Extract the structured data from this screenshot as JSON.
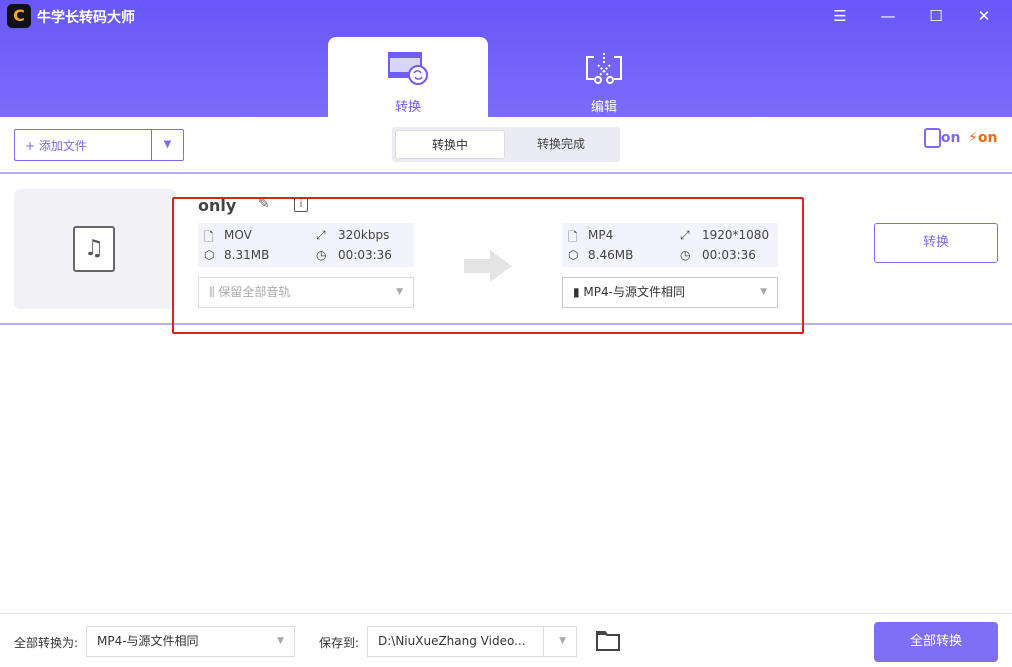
{
  "app": {
    "title": "牛学长转码大师",
    "logo": "C"
  },
  "window": {
    "menu": "☰",
    "minimize": "—",
    "maximize": "☐",
    "close": "✕"
  },
  "tabs": [
    {
      "label": "转换",
      "active": true
    },
    {
      "label": "编辑",
      "active": false
    }
  ],
  "toolbar": {
    "add_icon": "+",
    "add_label": "添加文件",
    "dropdown": "▼",
    "seg": [
      "转换中",
      "转换完成"
    ],
    "gpu_label": "on",
    "speed_label": "on"
  },
  "file": {
    "name": "only",
    "source": {
      "format": "MOV",
      "bitrate": "320kbps",
      "size": "8.31MB",
      "duration": "00:03:36",
      "audio_select": "保留全部音轨"
    },
    "target": {
      "format": "MP4",
      "resolution": "1920*1080",
      "size": "8.46MB",
      "duration": "00:03:36",
      "format_select": "MP4-与源文件相同"
    },
    "convert_label": "转换"
  },
  "footer": {
    "convert_all_to_label": "全部转换为:",
    "convert_all_to_value": "MP4-与源文件相同",
    "save_to_label": "保存到:",
    "save_to_value": "D:\\NiuXueZhang Video...",
    "convert_all_button": "全部转换"
  },
  "colors": {
    "accent": "#7b6cf3",
    "header": "#6757f9",
    "highlight": "#e02020",
    "speed": "#f26a0f"
  }
}
